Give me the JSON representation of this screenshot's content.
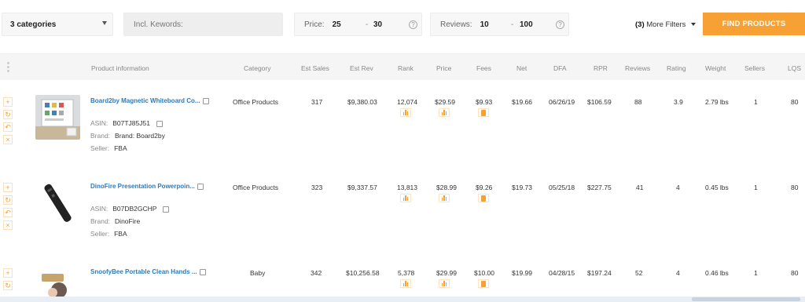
{
  "filters": {
    "categories": "3  categories",
    "keywords_placeholder": "Incl. Kewords:",
    "price_label": "Price:",
    "price_min": "25",
    "price_max": "30",
    "reviews_label": "Reviews:",
    "reviews_min": "10",
    "reviews_max": "100",
    "more_filters_count": "(3)",
    "more_filters_label": "More Filters",
    "find_button": "FIND PRODUCTS"
  },
  "columns": [
    "Product information",
    "Category",
    "Est Sales",
    "Est Rev",
    "Rank",
    "Price",
    "Fees",
    "Net",
    "DFA",
    "RPR",
    "Reviews",
    "Rating",
    "Weight",
    "Sellers",
    "LQS"
  ],
  "meta_labels": {
    "asin": "ASIN:",
    "brand": "Brand:",
    "seller": "Seller:"
  },
  "rows": [
    {
      "title": "Board2by Magnetic Whiteboard Co...",
      "asin": "B07TJ85J51",
      "brand": "Brand: Board2by",
      "seller": "FBA",
      "category": "Office Products",
      "est_sales": "317",
      "est_rev": "$9,380.03",
      "rank": "12,074",
      "price": "$29.59",
      "fees": "$9.93",
      "net": "$19.66",
      "dfa": "06/26/19",
      "rpr": "$106.59",
      "reviews": "88",
      "rating": "3.9",
      "weight": "2.79 lbs",
      "sellers": "1",
      "lqs": "80"
    },
    {
      "title": "DinoFire Presentation Powerpoin...",
      "asin": "B07DB2GCHP",
      "brand": "DinoFire",
      "seller": "FBA",
      "category": "Office Products",
      "est_sales": "323",
      "est_rev": "$9,337.57",
      "rank": "13,813",
      "price": "$28.99",
      "fees": "$9.26",
      "net": "$19.73",
      "dfa": "05/25/18",
      "rpr": "$227.75",
      "reviews": "41",
      "rating": "4",
      "weight": "0.45 lbs",
      "sellers": "1",
      "lqs": "80"
    },
    {
      "title": "SnoofyBee Portable Clean Hands ...",
      "category": "Baby",
      "est_sales": "342",
      "est_rev": "$10,256.58",
      "rank": "5,378",
      "price": "$29.99",
      "fees": "$10.00",
      "net": "$19.99",
      "dfa": "04/28/15",
      "rpr": "$197.24",
      "reviews": "52",
      "rating": "4",
      "weight": "0.46 lbs",
      "sellers": "1",
      "lqs": "80"
    }
  ],
  "icons": {
    "add": "+",
    "refresh": "↻",
    "undo": "↶",
    "remove": "×",
    "help": "?",
    "accent": "#f7a033",
    "link": "#2a7bbf"
  }
}
